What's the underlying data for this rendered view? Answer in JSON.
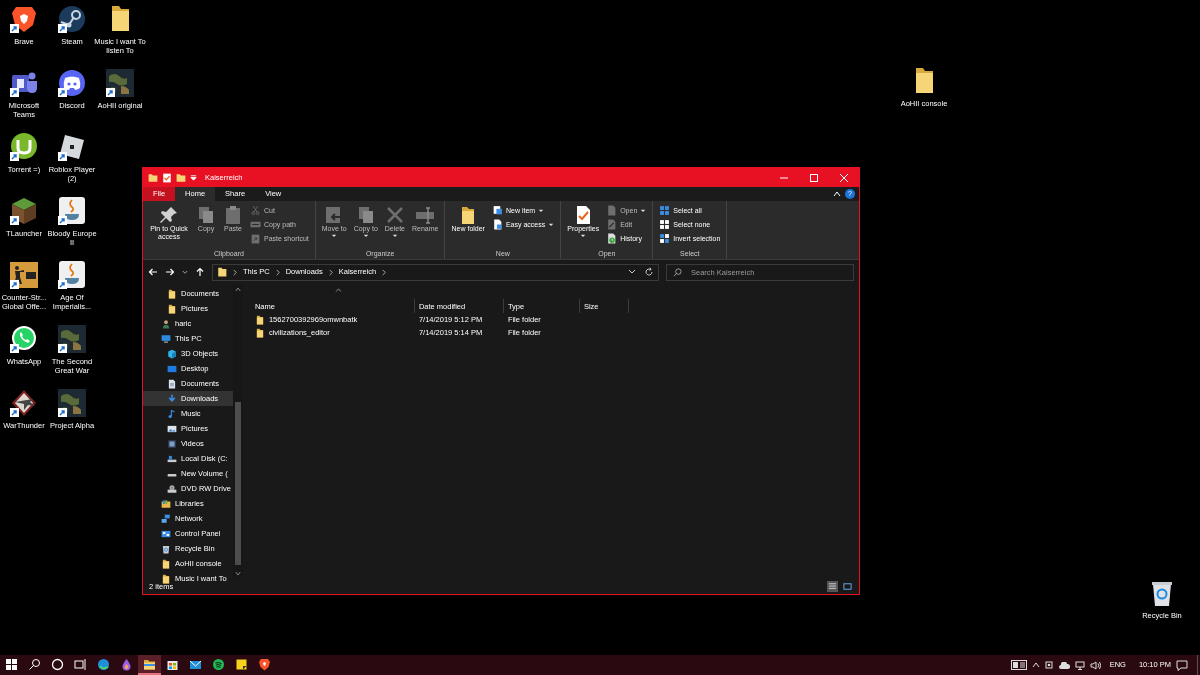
{
  "desktop_icons": [
    {
      "label": "Brave",
      "kind": "shortcut"
    },
    {
      "label": "Microsoft Teams",
      "kind": "shortcut"
    },
    {
      "label": "Torrent =)",
      "kind": "shortcut"
    },
    {
      "label": "TLauncher",
      "kind": "shortcut"
    },
    {
      "label": "Counter-Str... Global Offe...",
      "kind": "shortcut"
    },
    {
      "label": "WhatsApp",
      "kind": "shortcut"
    },
    {
      "label": "WarThunder",
      "kind": "shortcut"
    },
    {
      "label": "Steam",
      "kind": "shortcut"
    },
    {
      "label": "Discord",
      "kind": "shortcut"
    },
    {
      "label": "Roblox Player (2)",
      "kind": "shortcut"
    },
    {
      "label": "Bloody Europe II",
      "kind": "shortcut"
    },
    {
      "label": "Age Of Imperialis...",
      "kind": "shortcut"
    },
    {
      "label": "The Second Great War",
      "kind": "shortcut"
    },
    {
      "label": "Project Alpha",
      "kind": "shortcut"
    },
    {
      "label": "Music I want To listen To",
      "kind": "folder"
    },
    {
      "label": "AoHII original",
      "kind": "shortcut"
    }
  ],
  "desktop_side_icons": [
    {
      "label": "AoHII console",
      "kind": "folder"
    },
    {
      "label": "Recycle Bin",
      "kind": "recycle"
    }
  ],
  "explorer": {
    "title": "Kaiserreich",
    "ribbon_tabs": [
      {
        "label": "File",
        "kind": "file",
        "selected": false
      },
      {
        "label": "Home",
        "kind": "tab",
        "selected": true
      },
      {
        "label": "Share",
        "kind": "tab",
        "selected": false
      },
      {
        "label": "View",
        "kind": "tab",
        "selected": false
      }
    ],
    "help_label": "?",
    "ribbon_groups": [
      {
        "label": "Clipboard",
        "commands": [
          {
            "label": "Pin to Quick access",
            "kind": "large",
            "disabled": false,
            "dropdown": false
          },
          {
            "label": "Copy",
            "kind": "large",
            "disabled": true,
            "dropdown": false
          },
          {
            "label": "Paste",
            "kind": "large",
            "disabled": true,
            "dropdown": false
          },
          {
            "label": "Cut",
            "kind": "small",
            "disabled": true,
            "dropdown": false
          },
          {
            "label": "Copy path",
            "kind": "small",
            "disabled": true,
            "dropdown": false
          },
          {
            "label": "Paste shortcut",
            "kind": "small",
            "disabled": true,
            "dropdown": false
          }
        ]
      },
      {
        "label": "Organize",
        "commands": [
          {
            "label": "Move to",
            "kind": "large",
            "disabled": true,
            "dropdown": true
          },
          {
            "label": "Copy to",
            "kind": "large",
            "disabled": true,
            "dropdown": true
          },
          {
            "label": "Delete",
            "kind": "large",
            "disabled": true,
            "dropdown": true
          },
          {
            "label": "Rename",
            "kind": "large",
            "disabled": true,
            "dropdown": false
          }
        ]
      },
      {
        "label": "New",
        "commands": [
          {
            "label": "New folder",
            "kind": "large",
            "disabled": false,
            "dropdown": false
          },
          {
            "label": "New item",
            "kind": "small",
            "disabled": false,
            "dropdown": true
          },
          {
            "label": "Easy access",
            "kind": "small",
            "disabled": false,
            "dropdown": true
          }
        ]
      },
      {
        "label": "Open",
        "commands": [
          {
            "label": "Properties",
            "kind": "large",
            "disabled": false,
            "dropdown": true
          },
          {
            "label": "Open",
            "kind": "small",
            "disabled": true,
            "dropdown": true
          },
          {
            "label": "Edit",
            "kind": "small",
            "disabled": true,
            "dropdown": false
          },
          {
            "label": "History",
            "kind": "small",
            "disabled": false,
            "dropdown": false
          }
        ]
      },
      {
        "label": "Select",
        "commands": [
          {
            "label": "Select all",
            "kind": "small",
            "disabled": false,
            "dropdown": false
          },
          {
            "label": "Select none",
            "kind": "small",
            "disabled": false,
            "dropdown": false
          },
          {
            "label": "Invert selection",
            "kind": "small",
            "disabled": false,
            "dropdown": false
          }
        ]
      }
    ],
    "breadcrumbs": [
      "This PC",
      "Downloads",
      "Kaiserreich"
    ],
    "search": {
      "placeholder": "Search Kaiserreich"
    },
    "nav_items": [
      {
        "children": [
          {
            "label": "Documents",
            "kind": "folder",
            "selected": false
          },
          {
            "label": "Pictures",
            "kind": "folder",
            "selected": false
          }
        ]
      },
      {
        "label": "haric",
        "kind": "user",
        "selected": false
      },
      {
        "label": "This PC",
        "kind": "pc",
        "selected": false,
        "children": [
          {
            "label": "3D Objects",
            "kind": "objects",
            "selected": false
          },
          {
            "label": "Desktop",
            "kind": "desktop",
            "selected": false
          },
          {
            "label": "Documents",
            "kind": "documents",
            "selected": false
          },
          {
            "label": "Downloads",
            "kind": "downloads",
            "selected": true
          },
          {
            "label": "Music",
            "kind": "music",
            "selected": false
          },
          {
            "label": "Pictures",
            "kind": "pictures",
            "selected": false
          },
          {
            "label": "Videos",
            "kind": "videos",
            "selected": false
          },
          {
            "label": "Local Disk (C:",
            "kind": "drive",
            "selected": false
          },
          {
            "label": "New Volume (",
            "kind": "volume",
            "selected": false
          },
          {
            "label": "DVD RW Drive",
            "kind": "disc",
            "selected": false
          }
        ]
      },
      {
        "label": "Libraries",
        "kind": "library",
        "selected": false
      },
      {
        "label": "Network",
        "kind": "network",
        "selected": false
      },
      {
        "label": "Control Panel",
        "kind": "control",
        "selected": false
      },
      {
        "label": "Recycle Bin",
        "kind": "recycle",
        "selected": false
      },
      {
        "label": "AoHII console",
        "kind": "folder",
        "selected": false
      },
      {
        "label": "Music I want To",
        "kind": "folder",
        "selected": false
      }
    ],
    "table": {
      "columns": [
        "Name",
        "Date modified",
        "Type",
        "Size"
      ],
      "rows": [
        {
          "cells": [
            "1562700392969omwnbatk",
            "7/14/2019 5:12 PM",
            "File folder"
          ],
          "selected": false
        },
        {
          "cells": [
            "civilizations_editor",
            "7/14/2019 5:14 PM",
            "File folder"
          ],
          "selected": false
        }
      ]
    },
    "status": "2 items",
    "view_buttons": [
      {
        "selected": true
      },
      {
        "selected": false
      }
    ]
  },
  "taskbar": {
    "buttons": [
      {
        "selected": false
      },
      {
        "selected": false
      },
      {
        "selected": false
      },
      {
        "selected": false
      },
      {
        "selected": false
      },
      {
        "selected": false
      },
      {
        "selected": true
      },
      {
        "selected": false
      },
      {
        "selected": false
      },
      {
        "selected": false
      },
      {
        "selected": false
      },
      {
        "selected": false
      }
    ],
    "language": "ENG",
    "time": "10:10 PM"
  }
}
